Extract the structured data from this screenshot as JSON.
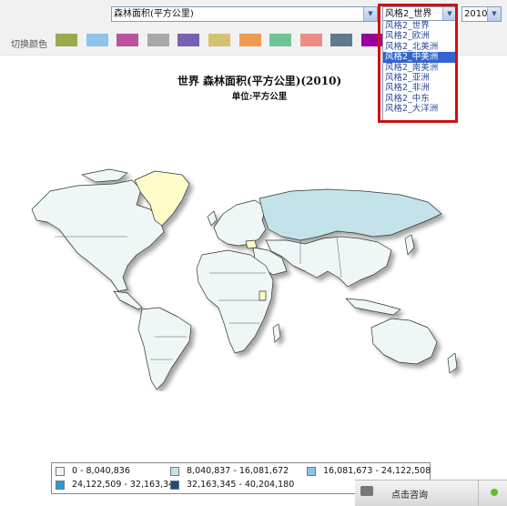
{
  "toolbar": {
    "indicator_select": "森林面积(平方公里)",
    "style_select": "风格2_世界",
    "year_select": "2010",
    "color_label": "切换颜色",
    "swatches": [
      "#9aaa4c",
      "#8ec4ea",
      "#b8549e",
      "#a8a8a8",
      "#7a60b0",
      "#d4c270",
      "#ee9c50",
      "#70c494",
      "#ec8c88",
      "#607a8c",
      "#9900a0",
      "#ff2020",
      "#44cc22"
    ]
  },
  "dropdown": {
    "options": [
      "风格2_世界",
      "风格2_欧洲",
      "风格2_北美洲",
      "风格2_中美洲",
      "风格2_南美洲",
      "风格2_亚洲",
      "风格2_非洲",
      "风格2_中东",
      "风格2_大洋洲"
    ],
    "selected_index": 3
  },
  "chart": {
    "title": "世界 森林面积(平方公里)(2010)",
    "subtitle": "单位:平方公里"
  },
  "legend": {
    "items": [
      {
        "label": "0 - 8,040,836",
        "color": "#eef6f6"
      },
      {
        "label": "8,040,837 - 16,081,672",
        "color": "#c4e2ea"
      },
      {
        "label": "16,081,673 - 24,122,508",
        "color": "#8cc4e8"
      },
      {
        "label": "24,122,509 - 32,163,344",
        "color": "#2a9ad8"
      },
      {
        "label": "32,163,345 - 40,204,180",
        "color": "#1a4a8a"
      }
    ]
  },
  "map_colors": {
    "default": "#eef6f6",
    "russia": "#c4e2ea",
    "greenland": "#fdfbc8",
    "border": "#333333"
  },
  "chat": {
    "label": "点击咨询"
  }
}
